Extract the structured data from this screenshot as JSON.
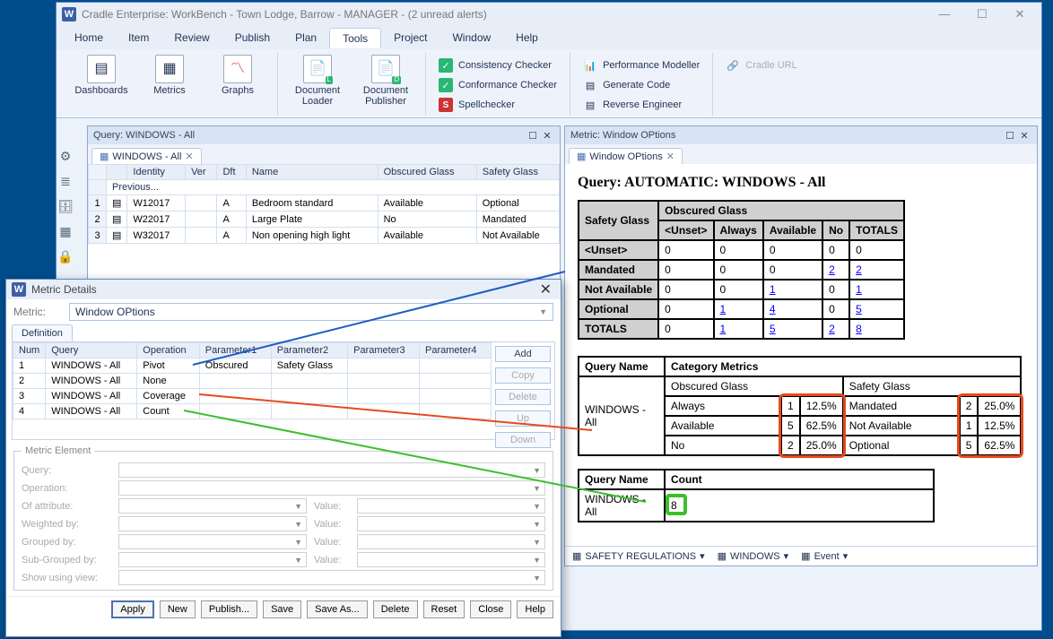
{
  "title": "Cradle Enterprise: WorkBench - Town Lodge, Barrow - MANAGER - (2 unread alerts)",
  "menus": {
    "home": "Home",
    "item": "Item",
    "review": "Review",
    "publish": "Publish",
    "plan": "Plan",
    "tools": "Tools",
    "project": "Project",
    "window": "Window",
    "help": "Help"
  },
  "ribbon": {
    "dashboards": "Dashboards",
    "metrics": "Metrics",
    "graphs": "Graphs",
    "docloader": "Document Loader",
    "docpub": "Document Publisher",
    "consistency": "Consistency Checker",
    "conformance": "Conformance Checker",
    "spell": "Spellchecker",
    "perf": "Performance Modeller",
    "gen": "Generate Code",
    "rev": "Reverse Engineer",
    "cradleurl": "Cradle URL"
  },
  "queryPanel": {
    "title": "Query: WINDOWS - All",
    "tab": "WINDOWS - All",
    "cols": {
      "identity": "Identity",
      "ver": "Ver",
      "dft": "Dft",
      "name": "Name",
      "obscured": "Obscured Glass",
      "safety": "Safety Glass"
    },
    "previous": "Previous...",
    "rows": [
      {
        "n": "1",
        "id": "W12017",
        "dft": "A",
        "name": "Bedroom standard",
        "obs": "Available",
        "saf": "Optional"
      },
      {
        "n": "2",
        "id": "W22017",
        "dft": "A",
        "name": "Large Plate",
        "obs": "No",
        "saf": "Mandated"
      },
      {
        "n": "3",
        "id": "W32017",
        "dft": "A",
        "name": "Non opening high light",
        "obs": "Available",
        "saf": "Not Available"
      }
    ]
  },
  "metricPanel": {
    "title": "Metric: Window OPtions",
    "tab": "Window OPtions",
    "heading": "Query: AUTOMATIC: WINDOWS - All",
    "pivot": {
      "top": "Obscured Glass",
      "left": "Safety Glass",
      "cols": [
        "<Unset>",
        "Always",
        "Available",
        "No",
        "TOTALS"
      ],
      "rows": [
        {
          "label": "<Unset>",
          "vals": [
            "0",
            "0",
            "0",
            "0",
            "0"
          ],
          "links": [
            false,
            false,
            false,
            false,
            false
          ]
        },
        {
          "label": "Mandated",
          "vals": [
            "0",
            "0",
            "0",
            "2",
            "2"
          ],
          "links": [
            false,
            false,
            false,
            true,
            true
          ]
        },
        {
          "label": "Not Available",
          "vals": [
            "0",
            "0",
            "1",
            "0",
            "1"
          ],
          "links": [
            false,
            false,
            true,
            false,
            true
          ]
        },
        {
          "label": "Optional",
          "vals": [
            "0",
            "1",
            "4",
            "0",
            "5"
          ],
          "links": [
            false,
            true,
            true,
            false,
            true
          ]
        },
        {
          "label": "TOTALS",
          "vals": [
            "0",
            "1",
            "5",
            "2",
            "8"
          ],
          "links": [
            false,
            true,
            true,
            true,
            true
          ]
        }
      ]
    },
    "category": {
      "queryName": "Query Name",
      "metricsHdr": "Category Metrics",
      "query": "WINDOWS - All",
      "leftCat": "Obscured Glass",
      "rightCat": "Safety Glass",
      "leftRows": [
        {
          "k": "Always",
          "n": "1",
          "p": "12.5%"
        },
        {
          "k": "Available",
          "n": "5",
          "p": "62.5%"
        },
        {
          "k": "No",
          "n": "2",
          "p": "25.0%"
        }
      ],
      "rightRows": [
        {
          "k": "Mandated",
          "n": "2",
          "p": "25.0%"
        },
        {
          "k": "Not Available",
          "n": "1",
          "p": "12.5%"
        },
        {
          "k": "Optional",
          "n": "5",
          "p": "62.5%"
        }
      ]
    },
    "count": {
      "queryName": "Query Name",
      "countHdr": "Count",
      "query": "WINDOWS - All",
      "value": "8"
    },
    "breadcrumbs": {
      "c1": "SAFETY REGULATIONS",
      "c2": "WINDOWS",
      "c3": "Event"
    }
  },
  "detail": {
    "title": "Metric Details",
    "metricLabel": "Metric:",
    "metricValue": "Window OPtions",
    "tab": "Definition",
    "cols": {
      "num": "Num",
      "query": "Query",
      "op": "Operation",
      "p1": "Parameter1",
      "p2": "Parameter2",
      "p3": "Parameter3",
      "p4": "Parameter4"
    },
    "rows": [
      {
        "n": "1",
        "q": "WINDOWS - All",
        "op": "Pivot",
        "p1": "Obscured",
        "p2": "Safety Glass"
      },
      {
        "n": "2",
        "q": "WINDOWS - All",
        "op": "None",
        "p1": "",
        "p2": ""
      },
      {
        "n": "3",
        "q": "WINDOWS - All",
        "op": "Coverage",
        "p1": "",
        "p2": ""
      },
      {
        "n": "4",
        "q": "WINDOWS - All",
        "op": "Count",
        "p1": "",
        "p2": ""
      }
    ],
    "btns": {
      "add": "Add",
      "copy": "Copy",
      "delete": "Delete",
      "up": "Up",
      "down": "Down"
    },
    "elementTitle": "Metric Element",
    "element": {
      "query": "Query:",
      "operation": "Operation:",
      "ofattr": "Of attribute:",
      "weighted": "Weighted by:",
      "grouped": "Grouped by:",
      "subgroup": "Sub-Grouped by:",
      "showview": "Show using view:",
      "value": "Value:"
    },
    "footer": {
      "apply": "Apply",
      "new": "New",
      "publish": "Publish...",
      "save": "Save",
      "saveas": "Save As...",
      "delete": "Delete",
      "reset": "Reset",
      "close": "Close",
      "help": "Help"
    }
  }
}
